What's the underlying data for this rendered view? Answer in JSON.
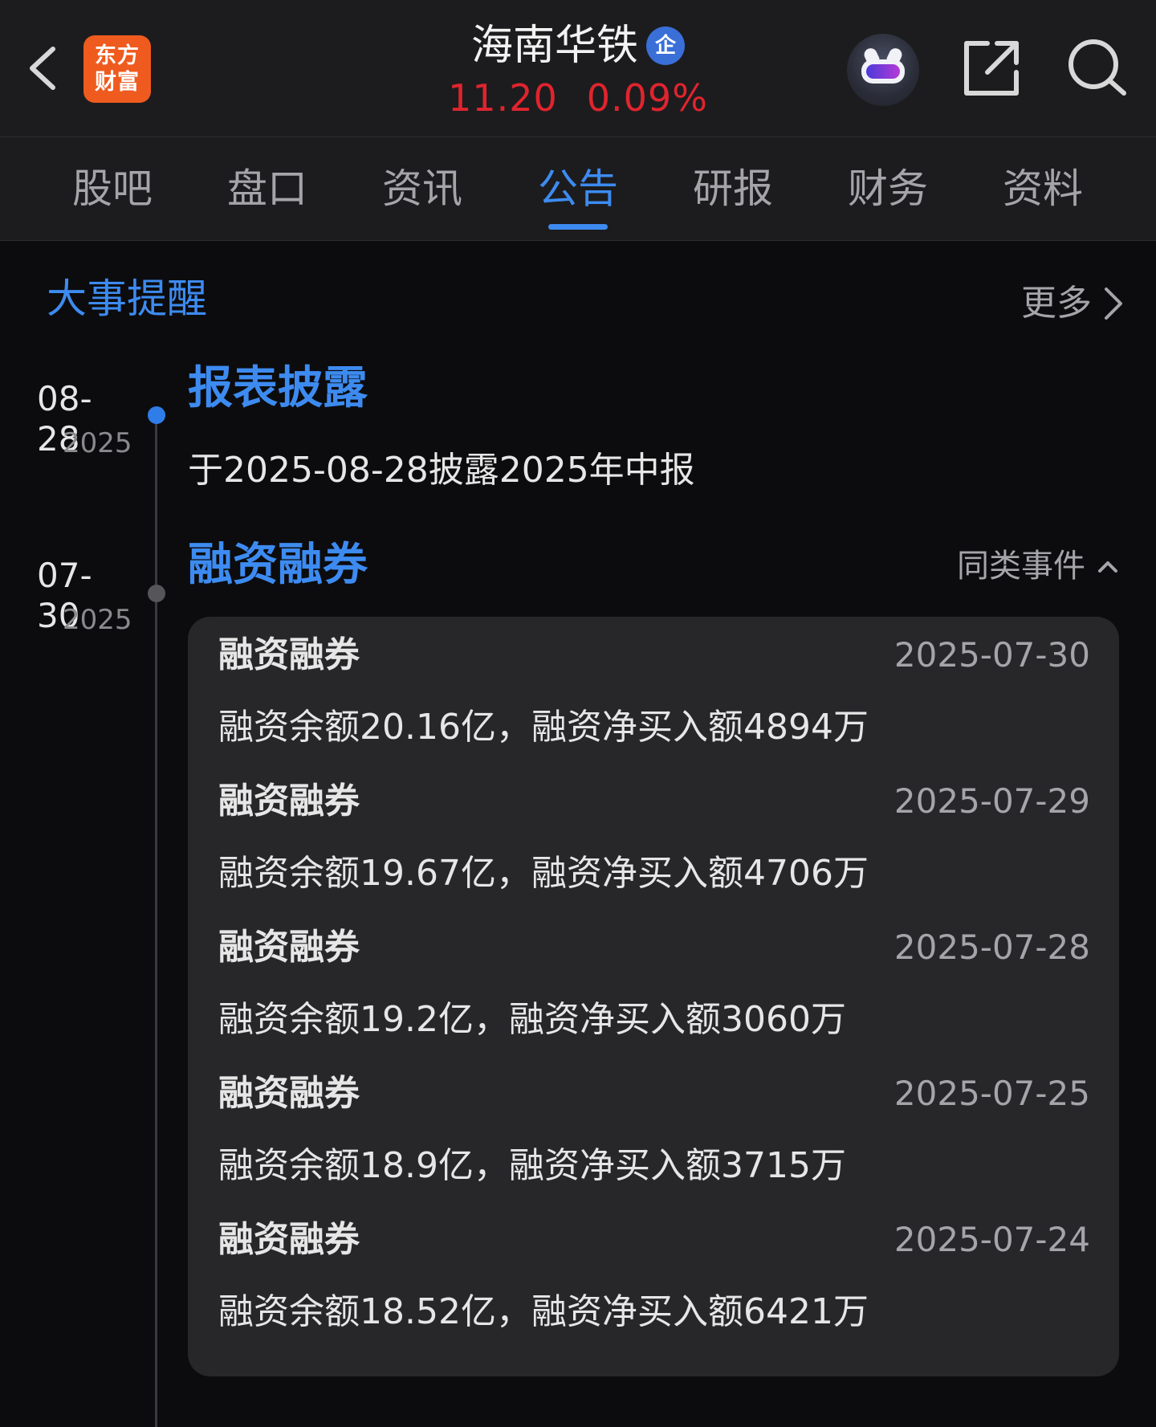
{
  "header": {
    "logo_line1": "东方",
    "logo_line2": "财富",
    "stock_name": "海南华铁",
    "badge": "企",
    "price": "11.20",
    "change_pct": "0.09%"
  },
  "tabs": [
    {
      "label": "股吧"
    },
    {
      "label": "盘口"
    },
    {
      "label": "资讯"
    },
    {
      "label": "公告"
    },
    {
      "label": "研报"
    },
    {
      "label": "财务"
    },
    {
      "label": "资料"
    }
  ],
  "active_tab": "公告",
  "section": {
    "title": "大事提醒",
    "more": "更多"
  },
  "events": [
    {
      "date_md": "08-28",
      "year": "2025",
      "title": "报表披露",
      "desc": "于2025-08-28披露2025年中报"
    },
    {
      "date_md": "07-30",
      "year": "2025",
      "title": "融资融券",
      "similar": "同类事件",
      "items": [
        {
          "title": "融资融券",
          "date": "2025-07-30",
          "desc": "融资余额20.16亿，融资净买入额4894万"
        },
        {
          "title": "融资融券",
          "date": "2025-07-29",
          "desc": "融资余额19.67亿，融资净买入额4706万"
        },
        {
          "title": "融资融券",
          "date": "2025-07-28",
          "desc": "融资余额19.2亿，融资净买入额3060万"
        },
        {
          "title": "融资融券",
          "date": "2025-07-25",
          "desc": "融资余额18.9亿，融资净买入额3715万"
        },
        {
          "title": "融资融券",
          "date": "2025-07-24",
          "desc": "融资余额18.52亿，融资净买入额6421万"
        }
      ]
    }
  ],
  "colors": {
    "accent": "#3d8bf0",
    "price_down_up": "#e0242e",
    "logo": "#ef5b1f",
    "background": "#0c0c0e",
    "card": "#27272a"
  },
  "icons": [
    "back-arrow-icon",
    "robot-assistant-icon",
    "share-icon",
    "search-icon",
    "chevron-right-icon",
    "chevron-up-icon"
  ]
}
